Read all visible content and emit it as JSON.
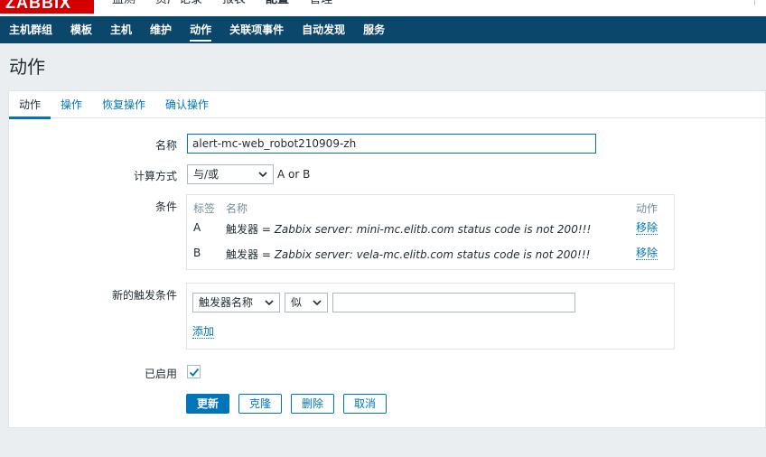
{
  "brand": {
    "logo_text": "ZABBIX",
    "color": "#d40000"
  },
  "top_menu": [
    "监测",
    "资产记录",
    "报表",
    "配置",
    "管理"
  ],
  "sub_nav": {
    "items": [
      "主机群组",
      "模板",
      "主机",
      "维护",
      "动作",
      "关联项事件",
      "自动发现",
      "服务"
    ],
    "active": "动作",
    "background": "#0b466b"
  },
  "page": {
    "title": "动作"
  },
  "tabs": [
    "动作",
    "操作",
    "恢复操作",
    "确认操作"
  ],
  "form": {
    "name_label": "名称",
    "name_value": "alert-mc-web_robot210909-zh",
    "calc_label": "计算方式",
    "calc_value": "与/或",
    "calc_formula": "A or B",
    "conditions_label": "条件",
    "conditions": {
      "headers": {
        "label": "标签",
        "name": "名称",
        "action": "动作"
      },
      "rows": [
        {
          "label": "A",
          "prefix": "触发器 = ",
          "value": "Zabbix server: mini-mc.elitb.com status code is not 200!!!",
          "action": "移除"
        },
        {
          "label": "B",
          "prefix": "触发器 = ",
          "value": "Zabbix server: vela-mc.elitb.com status code is not 200!!!",
          "action": "移除"
        }
      ]
    },
    "new_condition_label": "新的触发条件",
    "new_condition": {
      "type_value": "触发器名称",
      "operator_value": "似",
      "value": "",
      "add_label": "添加"
    },
    "enabled_label": "已启用",
    "enabled": true
  },
  "buttons": {
    "update": "更新",
    "clone": "克隆",
    "delete": "删除",
    "cancel": "取消"
  },
  "colors": {
    "accent": "#0275b8",
    "page_bg": "#ebeef0",
    "text": "#1f2c33"
  }
}
